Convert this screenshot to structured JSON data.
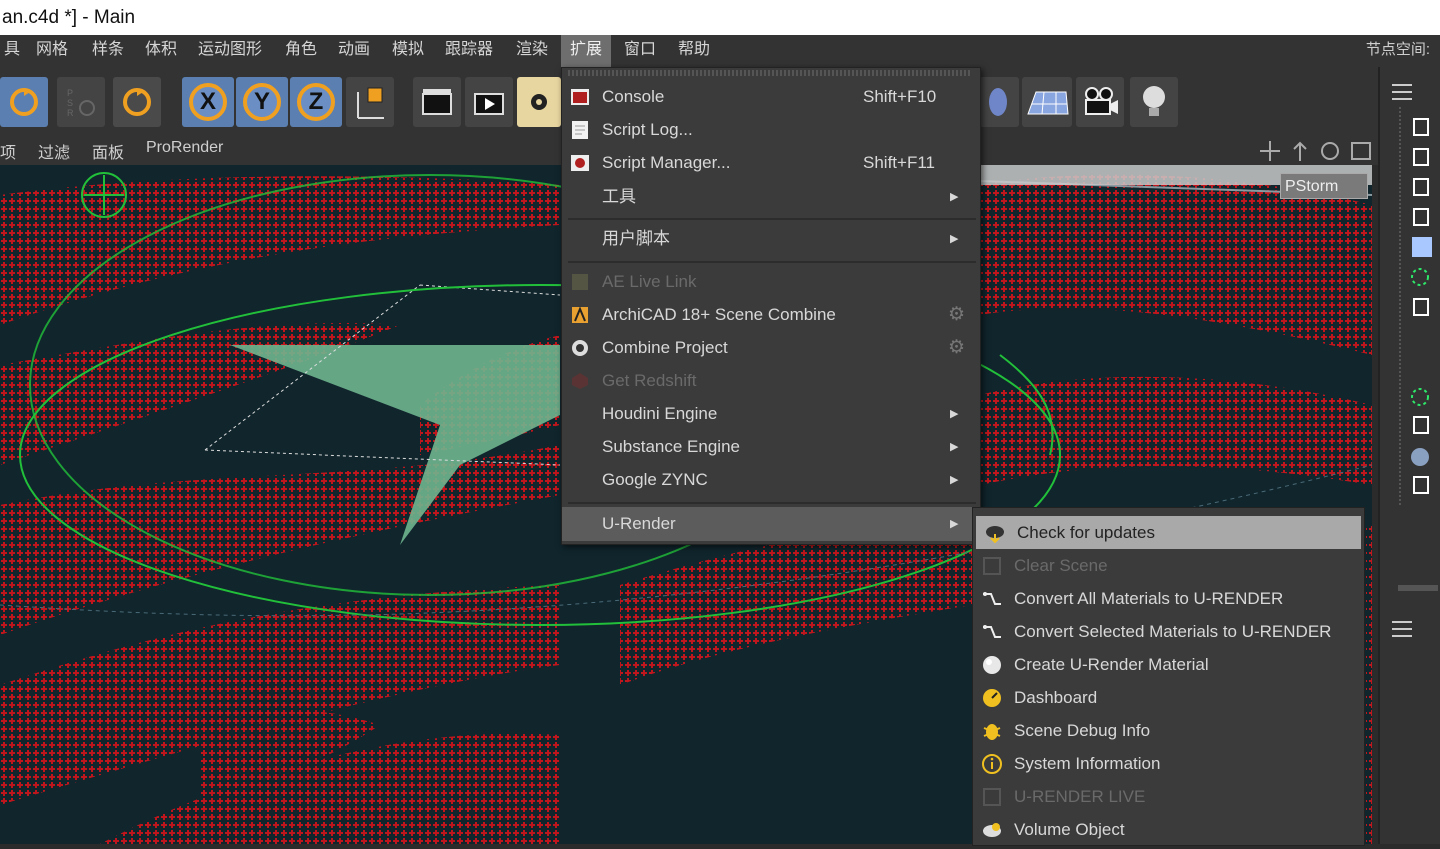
{
  "window": {
    "title": "an.c4d *] - Main"
  },
  "menubar": {
    "items": [
      "具",
      "网格",
      "样条",
      "体积",
      "运动图形",
      "角色",
      "动画",
      "模拟",
      "跟踪器",
      "渲染",
      "扩展",
      "窗口",
      "帮助"
    ],
    "active_index": 10,
    "right_label": "节点空间:"
  },
  "toolbar2": {
    "items": [
      "项",
      "过滤",
      "面板",
      "ProRender"
    ]
  },
  "viewport": {
    "badge": "PStorm"
  },
  "axes": [
    "X",
    "Y",
    "Z"
  ],
  "menu": {
    "console": {
      "label": "Console",
      "shortcut": "Shift+F10"
    },
    "script_log": {
      "label": "Script Log..."
    },
    "script_manager": {
      "label": "Script Manager...",
      "shortcut": "Shift+F11"
    },
    "tools": {
      "label": "工具"
    },
    "user_scripts": {
      "label": "用户脚本"
    },
    "ae_live_link": {
      "label": "AE Live Link"
    },
    "archicad": {
      "label": "ArchiCAD 18+ Scene Combine"
    },
    "combine_project": {
      "label": "Combine Project"
    },
    "get_redshift": {
      "label": "Get Redshift"
    },
    "houdini": {
      "label": "Houdini Engine"
    },
    "substance": {
      "label": "Substance Engine"
    },
    "zync": {
      "label": "Google ZYNC"
    },
    "urender": {
      "label": "U-Render"
    }
  },
  "submenu": {
    "items": [
      {
        "label": "Check for updates"
      },
      {
        "label": "Clear Scene"
      },
      {
        "label": "Convert All Materials to U-RENDER"
      },
      {
        "label": "Convert Selected Materials to U-RENDER"
      },
      {
        "label": "Create U-Render Material"
      },
      {
        "label": "Dashboard"
      },
      {
        "label": "Scene Debug Info"
      },
      {
        "label": "System Information"
      },
      {
        "label": "U-RENDER LIVE"
      },
      {
        "label": "Volume Object"
      }
    ]
  },
  "colors": {
    "menu_bg": "#3b3b3b",
    "highlight": "#a9a9a9",
    "viewport_bg": "#10252c",
    "points": "#c8161c",
    "wire": "#22c03a"
  }
}
